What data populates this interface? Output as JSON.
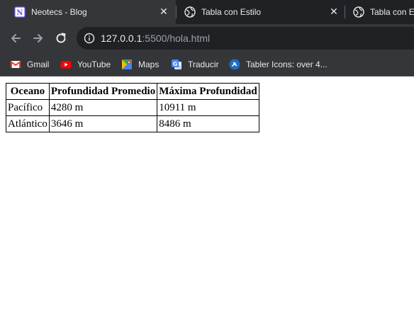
{
  "tabs": [
    {
      "title": "Neotecs - Blog",
      "icon": "notion-icon",
      "active": true
    },
    {
      "title": "Tabla con Estilo",
      "icon": "globe-icon",
      "active": false
    },
    {
      "title": "Tabla con Es",
      "icon": "globe-icon",
      "active": false
    }
  ],
  "address_bar": {
    "host": "127.0.0.1",
    "path": ":5500/hola.html"
  },
  "bookmarks": [
    {
      "label": "Gmail",
      "icon": "gmail-icon"
    },
    {
      "label": "YouTube",
      "icon": "youtube-icon"
    },
    {
      "label": "Maps",
      "icon": "maps-icon"
    },
    {
      "label": "Traducir",
      "icon": "translate-icon"
    },
    {
      "label": "Tabler Icons: over 4...",
      "icon": "tabler-icon"
    }
  ],
  "table": {
    "headers": [
      "Oceano",
      "Profundidad Promedio",
      "Máxima Profundidad"
    ],
    "rows": [
      [
        "Pacífico",
        "4280 m",
        "10911 m"
      ],
      [
        "Atlántico",
        "3646 m",
        "8486 m"
      ]
    ]
  },
  "colors": {
    "tabstrip_bg": "#202124",
    "toolbar_bg": "#35363a",
    "omnibox_bg": "#202124",
    "text_light": "#e8eaed",
    "text_dim": "#9aa0a6"
  }
}
